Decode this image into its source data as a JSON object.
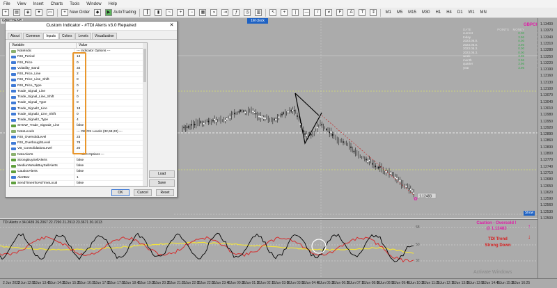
{
  "menu": [
    "File",
    "View",
    "Insert",
    "Charts",
    "Tools",
    "Window",
    "Help"
  ],
  "toolbar": {
    "new_order": "New Order",
    "autotrading": "AutoTrading",
    "timeframes": [
      "M1",
      "M5",
      "M15",
      "M30",
      "H1",
      "H4",
      "D1",
      "W1",
      "MN"
    ]
  },
  "chart_tab": "GBPCHF,M5",
  "badge_1m": "1M clock",
  "symbol": "GBPCHF",
  "stats": {
    "headers": [
      "DATE",
      "POINTS",
      "MONEY",
      "%"
    ],
    "rows": [
      {
        "label": "current",
        "points": "",
        "money": "0.00",
        "pct": "%"
      },
      {
        "label": "today",
        "points": "",
        "money": "3.96",
        "pct": "%"
      },
      {
        "label": "2023.06.0.",
        "points": "",
        "money": "0.00",
        "pct": "%"
      },
      {
        "label": "2023.06.0.",
        "points": "",
        "money": "3.96",
        "pct": "%"
      },
      {
        "label": "2023.05.3.",
        "points": "",
        "money": "0.00",
        "pct": "%"
      },
      {
        "label": "2023.05.3.",
        "points": "",
        "money": "0.00",
        "pct": "%"
      },
      {
        "label": "week",
        "points": "",
        "money": "3.96",
        "pct": "%"
      },
      {
        "label": "month",
        "points": "",
        "money": "3.96",
        "pct": "%"
      },
      {
        "label": "quarter",
        "points": "",
        "money": "3.96",
        "pct": "%"
      },
      {
        "label": "year",
        "points": "",
        "money": "3.96",
        "pct": "%"
      }
    ]
  },
  "price_labels": [
    "1.13400",
    "1.13370",
    "1.13340",
    "1.13310",
    "1.13280",
    "1.13250",
    "1.13220",
    "1.13190",
    "1.13160",
    "1.13130",
    "1.13100",
    "1.13070",
    "1.13040",
    "1.13010",
    "1.12980",
    "1.12950",
    "1.12920",
    "1.12890",
    "1.12860",
    "1.12830",
    "1.12800",
    "1.12770",
    "1.12740",
    "1.12710",
    "1.12680",
    "1.12650",
    "1.12620",
    "1.12590",
    "1.12560",
    "1.12530",
    "1.12500"
  ],
  "current_price": "1.12483",
  "show_label": "Show",
  "indicator_label": "TDI Alerts v 34.0439 26.2067 22.7290 21.2913 23.3671 30.1013",
  "ind_scale": [
    "68",
    "50",
    "32"
  ],
  "caution_line1": "Caution - Oversold !",
  "caution_line2": "@ 1.12483",
  "trend_line1": "TDI Trend",
  "trend_line2": "Strong Down",
  "time_labels": [
    "2 Jun 2023",
    "2 Jun 12:55",
    "2 Jun 13:45",
    "2 Jun 14:35",
    "2 Jun 15:25",
    "2 Jun 16:15",
    "2 Jun 17:05",
    "2 Jun 17:55",
    "2 Jun 18:45",
    "2 Jun 19:35",
    "2 Jun 20:25",
    "2 Jun 21:15",
    "2 Jun 22:05",
    "2 Jun 22:55",
    "2 Jun 23:45",
    "5 Jun 00:35",
    "5 Jun 01:25",
    "5 Jun 02:15",
    "5 Jun 03:05",
    "5 Jun 03:55",
    "5 Jun 04:45",
    "5 Jun 05:35",
    "5 Jun 06:25",
    "5 Jun 07:15",
    "5 Jun 08:05",
    "5 Jun 08:55",
    "5 Jun 09:45",
    "5 Jun 10:35",
    "5 Jun 11:25",
    "5 Jun 12:15",
    "5 Jun 13:05",
    "5 Jun 13:55",
    "5 Jun 14:45",
    "5 Jun 15:35",
    "5 Jun 16:25"
  ],
  "watermark": "Activate Windows",
  "dialog": {
    "title": "Custom Indicator - #TDI Alerts v3.0 Repaired",
    "tabs": [
      "About",
      "Common",
      "Inputs",
      "Colors",
      "Levels",
      "Visualization"
    ],
    "active_tab": "Inputs",
    "col_variable": "Variable",
    "col_value": "Value",
    "rows": [
      {
        "name": "NoteIndic",
        "value": "--- Indicator Options ---",
        "type": "ab"
      },
      {
        "name": "RSI_Period",
        "value": "13",
        "type": "num"
      },
      {
        "name": "RSI_Price",
        "value": "0",
        "type": "num"
      },
      {
        "name": "Volatility_Band",
        "value": "34",
        "type": "num"
      },
      {
        "name": "RSI_Price_Line",
        "value": "2",
        "type": "num"
      },
      {
        "name": "RSI_Price_Line_Shift",
        "value": "0",
        "type": "num"
      },
      {
        "name": "RSI_Price_Type",
        "value": "0",
        "type": "num"
      },
      {
        "name": "Trade_Signal_Line",
        "value": "7",
        "type": "num"
      },
      {
        "name": "Trade_Signal_Line_Shift",
        "value": "0",
        "type": "num"
      },
      {
        "name": "Trade_Signal_Type",
        "value": "0",
        "type": "num"
      },
      {
        "name": "Trade_Signal2_Line",
        "value": "18",
        "type": "num"
      },
      {
        "name": "Trade_Signal2_Line_Shift",
        "value": "0",
        "type": "num"
      },
      {
        "name": "Trade_Signal2_Type",
        "value": "4",
        "type": "num"
      },
      {
        "name": "SHOW_Trade_Signal2_Line",
        "value": "false",
        "type": "bool"
      },
      {
        "name": "NoteLevels",
        "value": "--- OB/OS Levels (32,68,20) ---",
        "type": "ab"
      },
      {
        "name": "RSI_OversoldLevel",
        "value": "23",
        "type": "num"
      },
      {
        "name": "RSI_OverboughtLevel",
        "value": "78",
        "type": "num"
      },
      {
        "name": "VB_ConsolidationLevel",
        "value": "20",
        "type": "num"
      },
      {
        "name": "NoteAlerts",
        "value": "--- Alert Options ---",
        "type": "ab"
      },
      {
        "name": "StrongBuySellAlerts",
        "value": "false",
        "type": "bool"
      },
      {
        "name": "MediumWeakBuySellAlerts",
        "value": "false",
        "type": "bool"
      },
      {
        "name": "CautionAlerts",
        "value": "false",
        "type": "bool"
      },
      {
        "name": "AlertBar",
        "value": "1",
        "type": "num"
      },
      {
        "name": "SendTimeInfoAsTimeLocal",
        "value": "false",
        "type": "bool"
      },
      {
        "name": "AlertOn",
        "value": "true",
        "type": "bool"
      },
      {
        "name": "AlertsMessage",
        "value": "true",
        "type": "bool"
      },
      {
        "name": "AlertsSound",
        "value": "false",
        "type": "bool"
      },
      {
        "name": "AlertsEmail",
        "value": "false",
        "type": "bool"
      }
    ],
    "btn_load": "Load",
    "btn_save": "Save",
    "btn_ok": "OK",
    "btn_cancel": "Cancel",
    "btn_reset": "Reset"
  }
}
